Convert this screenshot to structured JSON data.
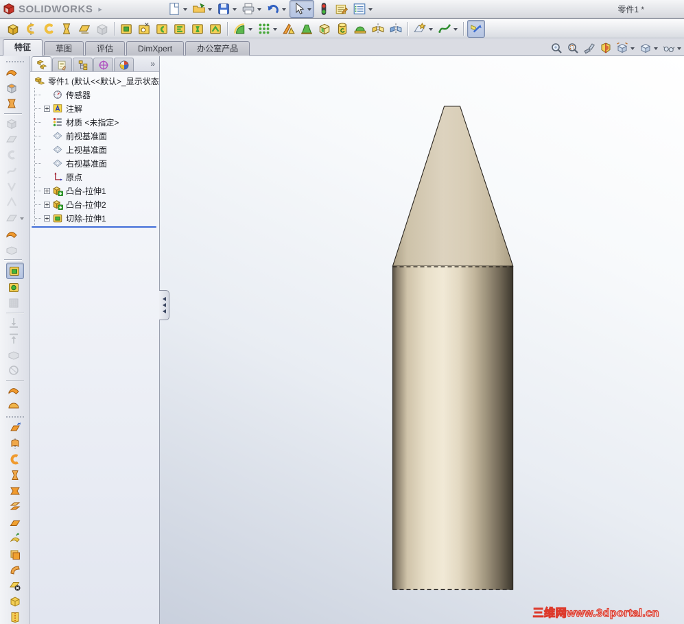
{
  "window": {
    "brand": "SOLIDWORKS",
    "title": "零件1 *"
  },
  "colors": {
    "accent_blue": "#3f6cd8",
    "watermark_red": "#dd3a2c",
    "feature_yellow": "#f3cf55",
    "feature_green": "#43b53c",
    "pencil_body": "#e9e0ca",
    "pencil_tip": "#dcd2bd"
  },
  "standard_toolbar": [
    {
      "name": "new-document",
      "glyph": "page",
      "dropdown": true
    },
    {
      "name": "open",
      "glyph": "folder",
      "dropdown": true
    },
    {
      "name": "save",
      "glyph": "floppy",
      "dropdown": true
    },
    {
      "name": "print",
      "glyph": "printer",
      "dropdown": true
    },
    {
      "name": "undo",
      "glyph": "undo",
      "dropdown": true
    },
    {
      "name": "select",
      "glyph": "cursor",
      "dropdown": true,
      "pressed": true
    },
    {
      "name": "rebuild-traffic-light",
      "glyph": "traffic"
    },
    {
      "name": "file-properties",
      "glyph": "propsheet"
    },
    {
      "name": "options",
      "glyph": "listform",
      "dropdown": true
    }
  ],
  "features_toolbar": [
    {
      "name": "extruded-boss",
      "glyph": "boss1"
    },
    {
      "name": "revolved-boss",
      "glyph": "revolve"
    },
    {
      "name": "swept-boss",
      "glyph": "sweptc"
    },
    {
      "name": "lofted-boss",
      "glyph": "loft"
    },
    {
      "name": "boundary-boss",
      "glyph": "boundary"
    },
    {
      "name": "feature-freeze",
      "glyph": "graycube",
      "disabled": true
    },
    {
      "sep": true
    },
    {
      "name": "extruded-cut",
      "glyph": "cut1"
    },
    {
      "name": "hole-wizard",
      "glyph": "holewiz"
    },
    {
      "name": "revolved-cut",
      "glyph": "cutrev"
    },
    {
      "name": "swept-cut",
      "glyph": "cutswept"
    },
    {
      "name": "lofted-cut",
      "glyph": "cutloft"
    },
    {
      "name": "boundary-cut",
      "glyph": "cutbound"
    },
    {
      "sep": true
    },
    {
      "name": "fillet",
      "glyph": "fillet",
      "dropdown": true
    },
    {
      "name": "linear-pattern",
      "glyph": "dots",
      "dropdown": true
    },
    {
      "name": "rib",
      "glyph": "rib"
    },
    {
      "name": "draft",
      "glyph": "draft"
    },
    {
      "name": "shell",
      "glyph": "shell"
    },
    {
      "name": "wrap",
      "glyph": "wrap"
    },
    {
      "name": "dome",
      "glyph": "dome"
    },
    {
      "name": "mirror",
      "glyph": "mirror"
    },
    {
      "name": "pattern-mirror-alt",
      "glyph": "mirror2"
    },
    {
      "sep": true
    },
    {
      "name": "reference-geometry",
      "glyph": "refgeo",
      "dropdown": true
    },
    {
      "name": "curves",
      "glyph": "spline",
      "dropdown": true
    },
    {
      "sep": true
    },
    {
      "name": "instant3d",
      "glyph": "instant3d",
      "pressed": true
    }
  ],
  "tabs": {
    "items": [
      {
        "label": "特征",
        "active": true
      },
      {
        "label": "草图"
      },
      {
        "label": "评估"
      },
      {
        "label": "DimXpert"
      },
      {
        "label": "办公室产品"
      }
    ]
  },
  "headsup_toolbar": [
    {
      "name": "zoom-to-fit",
      "glyph": "zoomfit"
    },
    {
      "name": "zoom-to-area",
      "glyph": "zoomarea"
    },
    {
      "name": "previous-view",
      "glyph": "prevview"
    },
    {
      "name": "section-view",
      "glyph": "section"
    },
    {
      "name": "view-orientation",
      "glyph": "vieworient",
      "dropdown": true
    },
    {
      "name": "display-style",
      "glyph": "dispstyle",
      "dropdown": true
    },
    {
      "name": "hide-show-items",
      "glyph": "glasses",
      "dropdown": true
    }
  ],
  "manager_tabs": [
    {
      "name": "feature-manager-tab",
      "glyph": "fmgr",
      "active": true
    },
    {
      "name": "property-manager-tab",
      "glyph": "pmgr"
    },
    {
      "name": "configuration-manager-tab",
      "glyph": "cmgr"
    },
    {
      "name": "dimxpert-manager-tab",
      "glyph": "dimx"
    },
    {
      "name": "display-manager-tab",
      "glyph": "dispmgr"
    }
  ],
  "manager_chevron": "»",
  "feature_tree": {
    "items": [
      {
        "label": "零件1  (默认<<默认>_显示状态",
        "icon": "t-part",
        "root": true
      },
      {
        "label": "传感器",
        "icon": "t-sensors"
      },
      {
        "label": "注解",
        "icon": "t-annot",
        "expand": true
      },
      {
        "label": "材质 <未指定>",
        "icon": "t-material"
      },
      {
        "label": "前视基准面",
        "icon": "t-plane"
      },
      {
        "label": "上视基准面",
        "icon": "t-plane"
      },
      {
        "label": "右视基准面",
        "icon": "t-plane"
      },
      {
        "label": "原点",
        "icon": "t-origin"
      },
      {
        "label": "凸台-拉伸1",
        "icon": "t-boss",
        "expand": true
      },
      {
        "label": "凸台-拉伸2",
        "icon": "t-boss",
        "expand": true
      },
      {
        "label": "切除-拉伸1",
        "icon": "t-cut",
        "expand": true
      }
    ]
  },
  "left_toolbar": {
    "groups": [
      [
        {
          "name": "ruled-surface",
          "glyph": "l-swoosh"
        },
        {
          "name": "planar-face-tool",
          "glyph": "l-graycube"
        },
        {
          "name": "loft-tool",
          "glyph": "l-loft"
        },
        {
          "sep": true
        },
        {
          "name": "disabled-tool-1",
          "glyph": "g-boss",
          "disabled": true
        },
        {
          "name": "disabled-tool-2",
          "glyph": "g-surf",
          "disabled": true
        },
        {
          "name": "disabled-tool-3",
          "glyph": "g-c",
          "disabled": true
        },
        {
          "name": "disabled-tool-4",
          "glyph": "g-s",
          "disabled": true
        },
        {
          "name": "disabled-tool-5",
          "glyph": "g-v",
          "disabled": true
        },
        {
          "name": "disabled-tool-6",
          "glyph": "g-a",
          "disabled": true
        },
        {
          "name": "disabled-tool-7",
          "glyph": "g-surf",
          "disabled": true,
          "dropdown": true
        },
        {
          "name": "surface-tool-4",
          "glyph": "l-swoosh"
        },
        {
          "name": "disabled-tool-8",
          "glyph": "g-box",
          "disabled": true
        },
        {
          "sep": true
        }
      ],
      [
        {
          "name": "extruded-cut-side",
          "glyph": "y-press",
          "pressed": true
        },
        {
          "name": "boss-tool-side",
          "glyph": "y-green"
        },
        {
          "name": "disabled-texture",
          "glyph": "g-tex",
          "disabled": true
        },
        {
          "sep": true
        },
        {
          "name": "draft-analysis-down",
          "glyph": "g-down",
          "disabled": true
        },
        {
          "name": "draft-analysis-up",
          "glyph": "g-up",
          "disabled": true
        },
        {
          "name": "disabled-box",
          "glyph": "g-box",
          "disabled": true
        },
        {
          "name": "disabled-sphere",
          "glyph": "g-ball",
          "disabled": true
        },
        {
          "sep": true
        },
        {
          "name": "surface-swoosh-2",
          "glyph": "l-swoosh"
        },
        {
          "name": "surface-half",
          "glyph": "o-half"
        },
        {
          "grip": true
        }
      ],
      [
        {
          "name": "extruded-surface",
          "glyph": "o-ext"
        },
        {
          "name": "revolved-surface",
          "glyph": "o-rev"
        },
        {
          "name": "swept-surface",
          "glyph": "o-c"
        },
        {
          "name": "lofted-surface",
          "glyph": "o-loft2"
        },
        {
          "name": "boundary-surface",
          "glyph": "o-x"
        },
        {
          "name": "offset-surface",
          "glyph": "o-off"
        },
        {
          "name": "planar-surface",
          "glyph": "o-plane"
        },
        {
          "name": "freeform-surface",
          "glyph": "o-free"
        },
        {
          "name": "thicken-surface",
          "glyph": "o-thick"
        },
        {
          "name": "flex-surface",
          "glyph": "o-bent"
        },
        {
          "name": "delete-face",
          "glyph": "o-del"
        },
        {
          "name": "replace-face",
          "glyph": "o-box"
        },
        {
          "name": "knit-surface",
          "glyph": "o-knit"
        }
      ]
    ]
  },
  "viewport": {
    "watermark": "三维网www.3dportal.cn"
  }
}
